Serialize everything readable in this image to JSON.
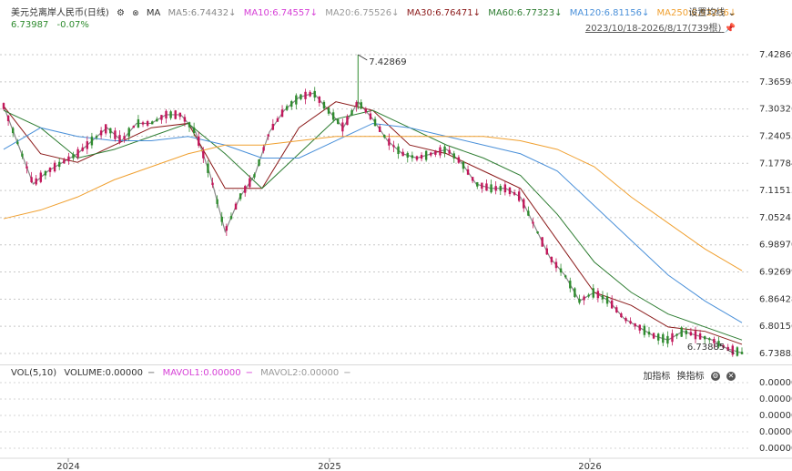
{
  "header": {
    "symbol": "美元兑离岸人民币(日线)",
    "ma_label": "MA",
    "ma": [
      {
        "label": "MA5:6.74432",
        "arrow": "↓",
        "color": "#888888"
      },
      {
        "label": "MA10:6.74557",
        "arrow": "↓",
        "color": "#d63fd6"
      },
      {
        "label": "MA20:6.75526",
        "arrow": "↓",
        "color": "#b0b0b0"
      },
      {
        "label": "MA30:6.76471",
        "arrow": "↓",
        "color": "#8b1a1a"
      },
      {
        "label": "MA60:6.77323",
        "arrow": "↓",
        "color": "#2e7d32"
      },
      {
        "label": "MA120:6.81156",
        "arrow": "↓",
        "color": "#4a90d9"
      },
      {
        "label": "MA250:6.93236",
        "arrow": "↓",
        "color": "#f0a030"
      }
    ],
    "price": "6.73987",
    "change": "-0.07%",
    "settings_label": "设置均线",
    "date_range": "2023/10/18-2026/8/17(739根)"
  },
  "volume": {
    "title": "VOL(5,10)",
    "volume": "VOLUME:0.00000",
    "mavol1": "MAVOL1:0.00000",
    "mavol2": "MAVOL2:0.00000",
    "add_indicator": "加指标",
    "switch_indicator": "换指标",
    "y_ticks": [
      "0.000000",
      "0.000000",
      "0.000000",
      "0.000000",
      "0.000000"
    ]
  },
  "colors": {
    "up": "#2e8b2e",
    "down": "#c2185b",
    "ma5": "#888888",
    "ma10": "#d63fd6",
    "ma20": "#b0b0b0",
    "ma30": "#8b1a1a",
    "ma60": "#2e7d32",
    "ma120": "#4a90d9",
    "ma250": "#f0a030"
  },
  "chart_data": {
    "type": "line",
    "title": "美元兑离岸人民币(日线)",
    "x_ticks": [
      "2024",
      "2025",
      "2026"
    ],
    "y_ticks": [
      "7.42869",
      "7.36598",
      "7.30326",
      "7.24055",
      "7.17784",
      "7.11513",
      "7.05241",
      "6.98970",
      "6.92699",
      "6.86428",
      "6.80156",
      "6.73885"
    ],
    "ylim": [
      6.73885,
      7.42869
    ],
    "annotations": [
      {
        "label": "7.42869",
        "value": 7.42869,
        "index": 0.48
      },
      {
        "label": "6.73885",
        "value": 6.73885,
        "index": 0.99
      }
    ],
    "series": [
      {
        "name": "price",
        "x": [
          0,
          0.02,
          0.04,
          0.06,
          0.08,
          0.1,
          0.12,
          0.14,
          0.16,
          0.18,
          0.2,
          0.22,
          0.24,
          0.26,
          0.28,
          0.3,
          0.32,
          0.34,
          0.36,
          0.38,
          0.4,
          0.42,
          0.44,
          0.46,
          0.48,
          0.5,
          0.52,
          0.54,
          0.56,
          0.58,
          0.6,
          0.62,
          0.64,
          0.66,
          0.68,
          0.7,
          0.72,
          0.74,
          0.76,
          0.78,
          0.8,
          0.82,
          0.84,
          0.86,
          0.88,
          0.9,
          0.92,
          0.94,
          0.96,
          0.98,
          1.0
        ],
        "values": [
          7.31,
          7.22,
          7.13,
          7.16,
          7.18,
          7.2,
          7.23,
          7.26,
          7.23,
          7.27,
          7.27,
          7.29,
          7.29,
          7.25,
          7.15,
          7.02,
          7.1,
          7.15,
          7.25,
          7.3,
          7.33,
          7.34,
          7.3,
          7.26,
          7.32,
          7.28,
          7.23,
          7.2,
          7.19,
          7.2,
          7.21,
          7.18,
          7.13,
          7.12,
          7.12,
          7.1,
          7.03,
          6.96,
          6.92,
          6.86,
          6.88,
          6.86,
          6.82,
          6.8,
          6.78,
          6.77,
          6.79,
          6.78,
          6.77,
          6.75,
          6.74
        ]
      },
      {
        "name": "MA30",
        "x": [
          0,
          0.05,
          0.1,
          0.15,
          0.2,
          0.25,
          0.3,
          0.35,
          0.4,
          0.45,
          0.5,
          0.55,
          0.6,
          0.65,
          0.7,
          0.75,
          0.8,
          0.85,
          0.9,
          0.95,
          1.0
        ],
        "values": [
          7.31,
          7.2,
          7.18,
          7.22,
          7.26,
          7.27,
          7.12,
          7.12,
          7.26,
          7.32,
          7.3,
          7.22,
          7.2,
          7.16,
          7.12,
          7.0,
          6.88,
          6.85,
          6.8,
          6.79,
          6.76
        ]
      },
      {
        "name": "MA60",
        "x": [
          0,
          0.05,
          0.1,
          0.15,
          0.2,
          0.25,
          0.3,
          0.35,
          0.4,
          0.45,
          0.5,
          0.55,
          0.6,
          0.65,
          0.7,
          0.75,
          0.8,
          0.85,
          0.9,
          0.95,
          1.0
        ],
        "values": [
          7.3,
          7.26,
          7.19,
          7.21,
          7.24,
          7.27,
          7.2,
          7.12,
          7.2,
          7.28,
          7.3,
          7.26,
          7.22,
          7.19,
          7.15,
          7.06,
          6.95,
          6.88,
          6.83,
          6.8,
          6.77
        ]
      },
      {
        "name": "MA120",
        "x": [
          0,
          0.05,
          0.1,
          0.15,
          0.2,
          0.25,
          0.3,
          0.35,
          0.4,
          0.45,
          0.5,
          0.55,
          0.6,
          0.65,
          0.7,
          0.75,
          0.8,
          0.85,
          0.9,
          0.95,
          1.0
        ],
        "values": [
          7.21,
          7.26,
          7.24,
          7.23,
          7.23,
          7.24,
          7.22,
          7.19,
          7.19,
          7.23,
          7.27,
          7.26,
          7.24,
          7.22,
          7.2,
          7.16,
          7.08,
          7.0,
          6.92,
          6.86,
          6.81
        ]
      },
      {
        "name": "MA250",
        "x": [
          0,
          0.05,
          0.1,
          0.15,
          0.2,
          0.25,
          0.3,
          0.35,
          0.4,
          0.45,
          0.5,
          0.55,
          0.6,
          0.65,
          0.7,
          0.75,
          0.8,
          0.85,
          0.9,
          0.95,
          1.0
        ],
        "values": [
          7.05,
          7.07,
          7.1,
          7.14,
          7.17,
          7.2,
          7.22,
          7.22,
          7.23,
          7.24,
          7.24,
          7.24,
          7.24,
          7.24,
          7.23,
          7.21,
          7.17,
          7.1,
          7.04,
          6.98,
          6.93
        ]
      }
    ]
  }
}
